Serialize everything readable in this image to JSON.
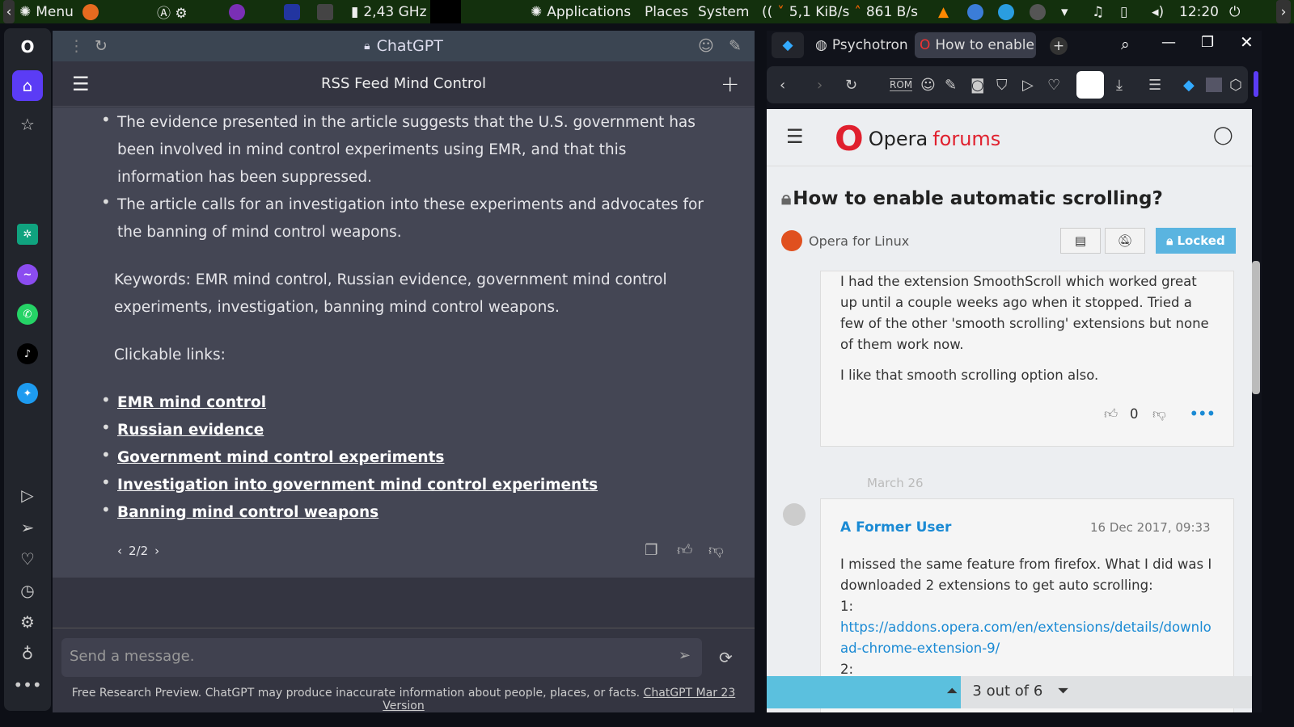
{
  "panel": {
    "menu": "Menu",
    "cpu": "2,43 GHz",
    "applications": "Applications",
    "places": "Places",
    "system": "System",
    "net_down": "5,1 KiB/s",
    "net_up": "861 B/s",
    "clock": "12:20"
  },
  "chatgpt": {
    "window_title": "ChatGPT",
    "chat_title": "RSS Feed Mind Control",
    "bullets": [
      "The evidence presented in the article suggests that the U.S. government has been involved in mind control experiments using EMR, and that this information has been suppressed.",
      "The article calls for an investigation into these experiments and advocates for the banning of mind control weapons."
    ],
    "keywords": "Keywords: EMR mind control, Russian evidence, government mind control experiments, investigation, banning mind control weapons.",
    "links_heading": "Clickable links:",
    "links": [
      "EMR mind control",
      "Russian evidence",
      "Government mind control experiments",
      "Investigation into government mind control experiments",
      "Banning mind control weapons"
    ],
    "pager": "2/2",
    "input_placeholder": "Send a message.",
    "footer": "Free Research Preview. ChatGPT may produce inaccurate information about people, places, or facts.",
    "footer_link": "ChatGPT Mar 23 Version"
  },
  "browser": {
    "tabs": [
      {
        "label": "Psychotron"
      },
      {
        "label": "How to enable"
      }
    ],
    "toolbar_rom": "ROM",
    "forum": {
      "logo_a": "Opera",
      "logo_b": "forums",
      "topic": "How to enable automatic scrolling?",
      "category": "Opera for Linux",
      "locked": "Locked",
      "post1": [
        "I had the extension SmoothScroll which worked great up until a couple weeks ago when it stopped. Tried a few of the other 'smooth scrolling' extensions but none of them work now.",
        "I like that smooth scrolling option also."
      ],
      "votes": "0",
      "date_sep": "March 26",
      "post2": {
        "author": "A Former User",
        "date": "16 Dec 2017, 09:33",
        "text": "I missed the same feature from firefox. What I did was I downloaded 2 extensions to get auto scrolling:",
        "n1": "1:",
        "link": "https://addons.opera.com/en/extensions/details/download-chrome-extension-9/",
        "n2": "2:"
      },
      "pagination": "3 out of 6"
    }
  },
  "colors": {
    "accent_opera": "#5b3cf5",
    "forum_link": "#1a8ad4",
    "locked": "#5ab4e0"
  }
}
